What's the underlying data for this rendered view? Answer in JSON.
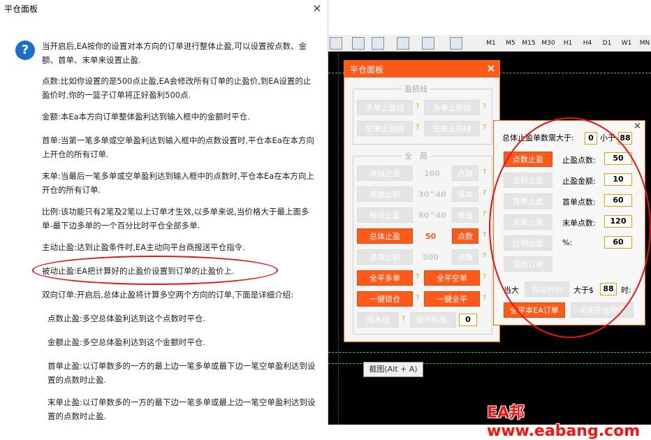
{
  "help": {
    "title": "平仓面板",
    "close": "×",
    "icon": "?",
    "paragraphs": [
      "当开启后,EA按你的设置对本方向的订单进行整体止盈,可以设置按点数、金额、首单、末单来设置止盈.",
      "点数:比如你设置的是500点止盈,EA会修改所有订单的止盈价,到EA设置的止盈价时,你的一篮子订单将正好盈利500点.",
      "金额:本Ea本方向订单整体盈利达到输入框中的金额时平仓.",
      "首单:当第一笔多单或空单盈利达到输入框中的点数设置时,平仓本Ea在本方向上开仓的所有订单.",
      "末单:当最后一笔多单或空单盈利达到输入框中的点数时,平仓本Ea在本方向上开仓的所有订单.",
      "比例:该功能只有2笔及2笔以上订单才生效,以多单来说,当价格大于最上面多单-最下边多单的一个百分比时平仓全部多单.",
      "主动止盈:达到止盈条件时,EA主动向平台商报送平仓指令.",
      "被动止盈:EA把计算好的止盈价设置到订单的止盈价上.",
      "双向订单:开启后,总体止盈将计算多空两个方向的订单,下面是详细介绍:",
      "点数止盈:多空总体盈利达到这个点数时平仓.",
      "金额止盈:多空总体盈利达到这个金额时平仓.",
      "首单止盈:以订单数多的一方的最上边一笔多单或最下边一笔空单盈利达到设置的点数时止盈.",
      "末单止盈:以订单数多的一方的最下边一笔多单或最上边一笔空单盈利达到设置的点数时止盈."
    ]
  },
  "toolbar": {
    "timeframes": [
      "M1",
      "M5",
      "M15",
      "M30",
      "H1",
      "H4",
      "D1",
      "W1",
      "MN"
    ]
  },
  "panel": {
    "title": "平仓面板",
    "close": "×",
    "group1_label": "盈损线",
    "group2_label": "全　局",
    "b_long_tp": "多单止盈线",
    "b_long_sl": "多单止损线",
    "b_short_tp": "空单止盈线",
    "b_short_sl": "空单止损线",
    "b_single_tp": "单独止盈",
    "v_single_tp": "100",
    "b_pts1": "点数",
    "b_single_sl": "单独止损",
    "v_single_sl": "30^40",
    "b_protect": "保本",
    "b_move_tp": "移动止盈",
    "v_move_tp": "80^40",
    "b_single": "单独",
    "b_total_tp": "总体止盈",
    "v_total_tp": "50",
    "b_pts2": "点数",
    "b_total_sl": "总体止损",
    "v_total_sl": "500",
    "b_pts3": "点数",
    "b_close_long": "全平多单",
    "b_close_short": "全平空单",
    "b_lock": "一键锁仓",
    "b_close_all": "一键全平",
    "b_cost": "成本线",
    "l_extra": "额外利息:",
    "v_extra": "0",
    "q": "?"
  },
  "panel2": {
    "close": "×",
    "l_need": "总体止盈单数需大于:",
    "v_need": "0",
    "l_less": "小于",
    "v_less": "88",
    "b_pts": "点数止盈",
    "l_pts": "止盈点数:",
    "v_pts": "50",
    "b_amt": "金额止盈",
    "l_amt": "止盈金额:",
    "v_amt": "10",
    "b_first": "首单止盈",
    "l_first": "首单点数:",
    "v_first": "60",
    "b_last": "末单止盈",
    "l_last": "末单点数:",
    "v_last": "120",
    "b_ratio": "比例止盈",
    "l_ratio": "%:",
    "v_ratio": "60",
    "b_bidir": "双向订单",
    "l_when": "当大",
    "b_hidden": "自动开启",
    "l_gt": "大于$",
    "v_gt": "88",
    "l_time": "时:",
    "b_close_ea": "全平本EA订单",
    "b_close_btn": "关闭开仓按钮"
  },
  "tooltip": "截图(Alt + A)",
  "watermark": "EA邦 www.eabang.com",
  "colors": {
    "accent": "#ff5a1a",
    "annotation": "#ee1111",
    "question": "#1b6fc9"
  }
}
